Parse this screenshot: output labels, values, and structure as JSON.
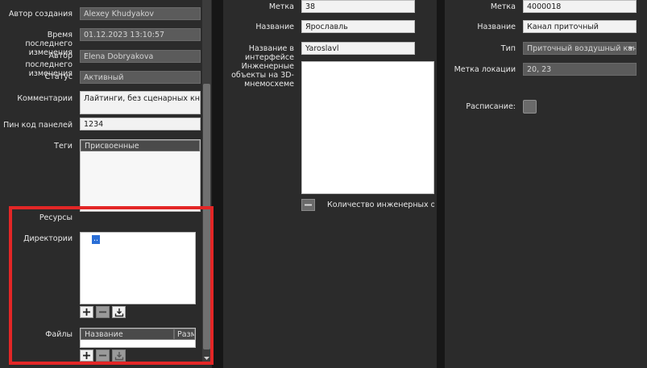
{
  "left": {
    "author_label": "Автор создания",
    "author_value": "Alexey Khudyakov",
    "mtime_label_1": "Время последнего",
    "mtime_label_2": "изменения",
    "mtime_value": "01.12.2023 13:10:57",
    "editor_label_1": "Автор последнего",
    "editor_label_2": "изменения",
    "editor_value": "Elena Dobryakova",
    "status_label": "Статус",
    "status_value": "Активный",
    "comments_label": "Комментарии",
    "comments_value": "Лайтинги, без сценарных кнопок",
    "pin_label": "Пин код панелей",
    "pin_value": "1234",
    "tags_label": "Теги",
    "tags_header": "Присвоенные",
    "resources_label": "Ресурсы",
    "dirs_label": "Директории",
    "dirs_item": "..",
    "files_label": "Файлы",
    "files_col_name": "Название",
    "files_col_size": "Разме"
  },
  "middle": {
    "tag_label": "Метка",
    "tag_value": "38",
    "name_label": "Название",
    "name_value": "Ярославль",
    "ui_name_label_1": "Название в",
    "ui_name_label_2": "интерфейсе",
    "ui_name_value": "Yaroslavl",
    "eng_label_1": "Инженерные",
    "eng_label_2": "объекты на 3D-",
    "eng_label_3": "мнемосхеме",
    "eng_count": "Количество инженерных объек"
  },
  "right": {
    "tag_label": "Метка",
    "tag_value": "4000018",
    "name_label": "Название",
    "name_value": "Канал приточный",
    "type_label": "Тип",
    "type_value": "Приточный воздушный кана",
    "loc_label": "Метка локации",
    "loc_value": "20, 23",
    "schedule_label": "Расписание:"
  },
  "highlight_color": "#e32626"
}
